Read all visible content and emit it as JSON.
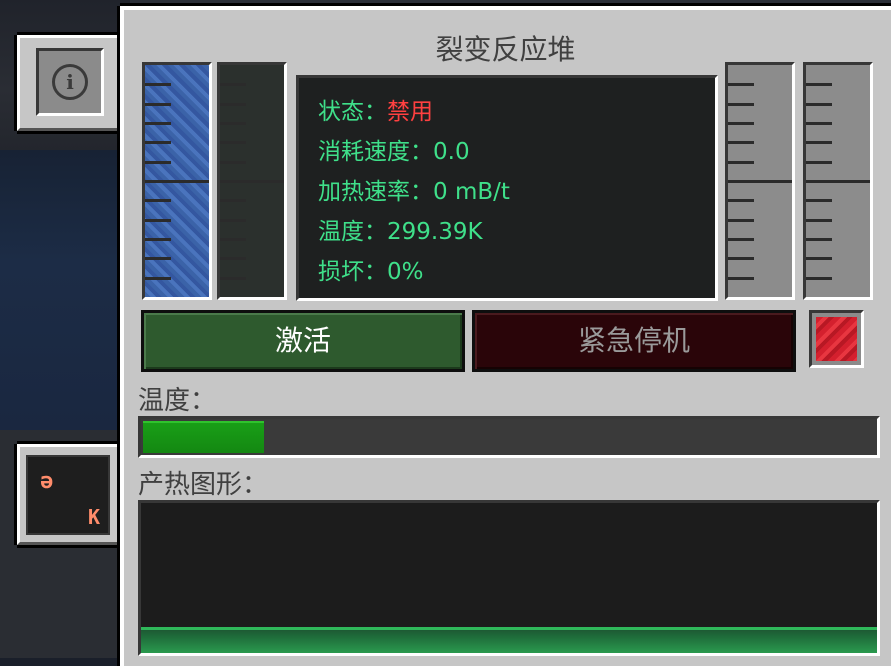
{
  "window": {
    "title": "裂变反应堆"
  },
  "tabs": [
    {
      "name": "info-tab",
      "icon": "info-icon",
      "glyph": "i"
    },
    {
      "name": "temperature-tab",
      "icon": "temperature-units-icon",
      "glyph_top": "ǝ",
      "glyph_bottom": "K"
    }
  ],
  "gauges": {
    "coolant_water": {
      "level": 1.0,
      "color": "#3b63a8",
      "icon": "water-tank-gauge"
    },
    "heated_coolant": {
      "level": 0.0,
      "icon": "steam-tank-gauge"
    },
    "fuel": {
      "level": 0.0,
      "icon": "fuel-tank-gauge"
    },
    "waste": {
      "level": 0.0,
      "icon": "waste-tank-gauge"
    }
  },
  "status": {
    "state_label": "状态：",
    "state_value": "禁用",
    "burn_label": "消耗速度：",
    "burn_value": "0.0",
    "heat_label": "加热速率：",
    "heat_value": "0 mB/t",
    "temp_label": "温度：",
    "temp_value": "299.39K",
    "damage_label": "损坏：",
    "damage_value": "0%",
    "colors": {
      "text": "#3fe08a",
      "disabled": "#ff4040"
    }
  },
  "buttons": {
    "activate_label": "激活",
    "scram_label": "紧急停机",
    "auto_scram_icon": "red-toggle-icon"
  },
  "temperature": {
    "label": "温度：",
    "level": 0.165,
    "color": "#19a017"
  },
  "heat_graph": {
    "label": "产热图形：",
    "line_color": "#2fb85a"
  }
}
